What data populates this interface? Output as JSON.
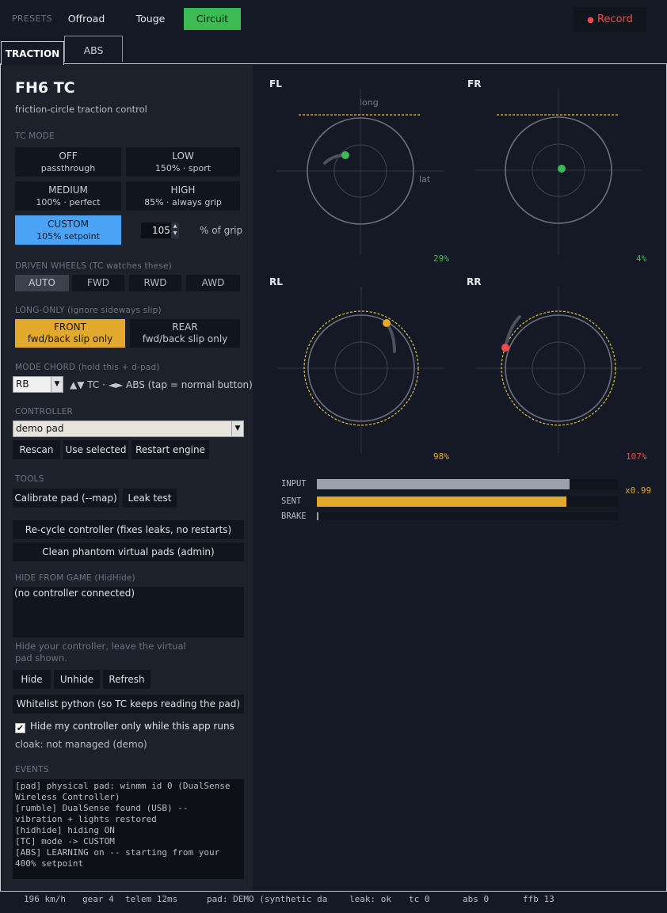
{
  "presets": {
    "label": "PRESETS",
    "items": [
      "Offroad",
      "Touge",
      "Circuit"
    ],
    "active": "Circuit"
  },
  "record_label": "Record",
  "tabs": [
    "TRACTION",
    "ABS"
  ],
  "traction": {
    "title": "FH6 TC",
    "subtitle": "friction-circle traction control",
    "tc_mode": {
      "label": "TC MODE",
      "modes": [
        {
          "name": "OFF",
          "desc": "passthrough"
        },
        {
          "name": "LOW",
          "desc": "150% · sport"
        },
        {
          "name": "MEDIUM",
          "desc": "100% · perfect"
        },
        {
          "name": "HIGH",
          "desc": "85% · always grip"
        },
        {
          "name": "CUSTOM",
          "desc": "105% setpoint"
        }
      ],
      "active": "CUSTOM",
      "custom_value": "105",
      "grip_label": "% of grip"
    },
    "driven_wheels": {
      "label": "DRIVEN WHEELS  (TC watches these)",
      "options": [
        "AUTO",
        "FWD",
        "RWD",
        "AWD"
      ],
      "active": "AUTO"
    },
    "long_only": {
      "label": "LONG-ONLY  (ignore sideways slip)",
      "options": [
        {
          "name": "FRONT",
          "desc": "fwd/back slip only"
        },
        {
          "name": "REAR",
          "desc": "fwd/back slip only"
        }
      ],
      "active": "FRONT"
    },
    "mode_chord": {
      "label": "MODE CHORD  (hold this + d-pad)",
      "selected": "RB",
      "hint": "▲▼ TC · ◄► ABS  (tap = normal button)"
    },
    "controller": {
      "label": "CONTROLLER",
      "selected": "demo pad",
      "buttons": [
        "Rescan",
        "Use selected",
        "Restart engine"
      ]
    },
    "tools": {
      "label": "TOOLS",
      "buttons": [
        "Calibrate pad (--map)",
        "Leak test",
        "Re-cycle controller (fixes leaks, no restarts)",
        "Clean phantom virtual pads (admin)"
      ]
    },
    "hide": {
      "label": "HIDE FROM GAME  (HidHide)",
      "list_text": "(no controller connected)",
      "hint": "Hide your controller, leave the virtual pad shown.",
      "buttons": [
        "Hide",
        "Unhide",
        "Refresh"
      ],
      "whitelist_button": "Whitelist python (so TC keeps reading the pad)",
      "checkbox_label": "Hide my controller only while this app runs",
      "checkbox_checked": true,
      "cloak_status": "cloak: not managed (demo)"
    },
    "events": {
      "label": "EVENTS",
      "log": "[pad] physical pad: winmm id 0 (DualSense\nWireless Controller)\n[rumble] DualSense found (USB) --\nvibration + lights restored\n[hidhide] hiding ON\n[TC] mode -> CUSTOM\n[ABS] LEARNING on -- starting from your\n400% setpoint"
    }
  },
  "wheels": [
    {
      "label": "FL",
      "pct": "29%",
      "color": "#3cba54",
      "axis_long": "long",
      "axis_lat": "lat"
    },
    {
      "label": "FR",
      "pct": "4%",
      "color": "#3cba54"
    },
    {
      "label": "RL",
      "pct": "98%",
      "color": "#e2a92d"
    },
    {
      "label": "RR",
      "pct": "107%",
      "color": "#ef4b4b"
    }
  ],
  "bars": [
    {
      "label": "INPUT",
      "value": 0.84,
      "color": "#9ca0aa"
    },
    {
      "label": "SENT",
      "value": 0.83,
      "color": "#e2a92d"
    },
    {
      "label": "BRAKE",
      "value": 0.005,
      "color": "#9ca0aa"
    }
  ],
  "multiplier": "x0.99",
  "status": {
    "speed": "196 km/h",
    "gear": "gear 4",
    "telem": "telem  12ms",
    "pad": "pad: DEMO (synthetic da",
    "leak": "leak: ok",
    "tc": "tc 0",
    "abs": "abs 0",
    "ffb": "ffb 13"
  }
}
